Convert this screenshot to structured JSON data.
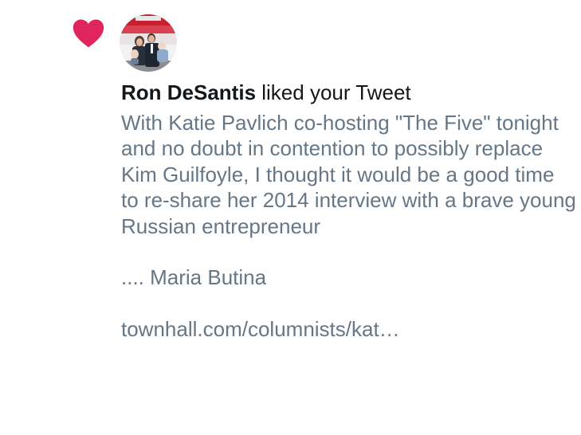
{
  "notification": {
    "icon": "heart-icon",
    "heart_color": "#e0245e",
    "avatar": "user-avatar-photo",
    "liker_name": "Ron DeSantis",
    "action_text": " liked your Tweet",
    "tweet": {
      "paragraph_1": "With Katie Pavlich co-hosting \"The Five\" tonight and no doubt in contention to possibly replace Kim Guilfoyle, I thought it would be a good time to re-share her 2014 interview with a brave young Russian entrepreneur",
      "paragraph_2": ".... Maria Butina",
      "link": "townhall.com/columnists/kat…"
    }
  },
  "colors": {
    "name_text": "#14171a",
    "body_text": "#657786",
    "background": "#ffffff"
  }
}
